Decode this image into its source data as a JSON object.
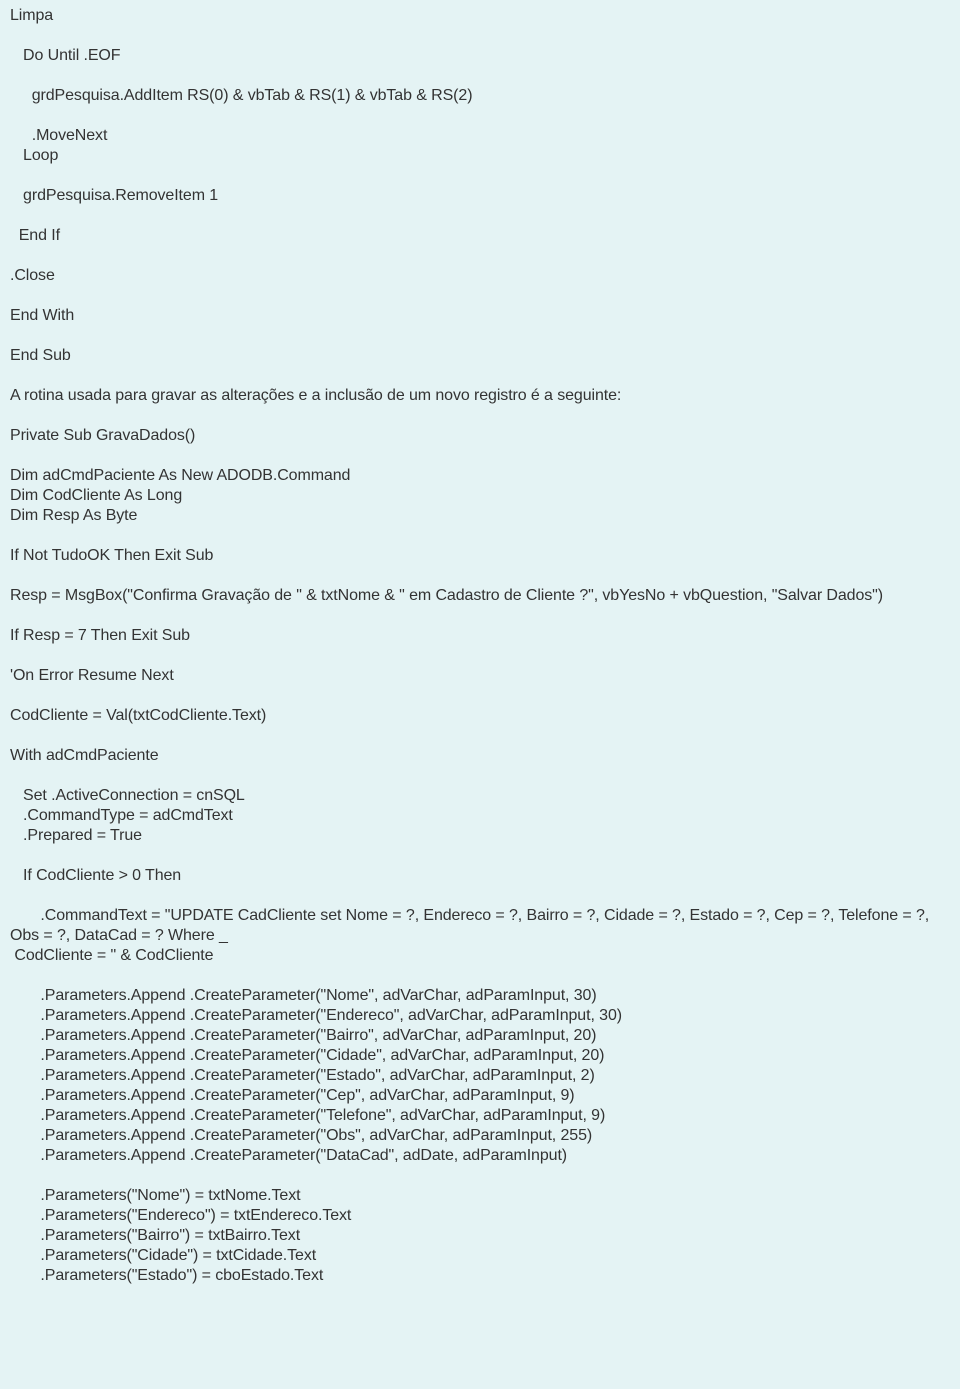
{
  "blocks": {
    "code1": "Limpa\n\n   Do Until .EOF\n\n     grdPesquisa.AddItem RS(0) & vbTab & RS(1) & vbTab & RS(2)\n\n     .MoveNext\n   Loop\n\n   grdPesquisa.RemoveItem 1\n\n  End If\n\n.Close\n\nEnd With\n\nEnd Sub",
    "para1": "A rotina usada para gravar as alterações e a inclusão de um novo registro é a seguinte:",
    "code2": "Private Sub GravaDados()\n\nDim adCmdPaciente As New ADODB.Command\nDim CodCliente As Long\nDim Resp As Byte\n\nIf Not TudoOK Then Exit Sub\n\nResp = MsgBox(\"Confirma Gravação de \" & txtNome & \" em Cadastro de Cliente ?\", vbYesNo + vbQuestion, \"Salvar Dados\")\n\nIf Resp = 7 Then Exit Sub\n\n'On Error Resume Next\n\nCodCliente = Val(txtCodCliente.Text)\n\nWith adCmdPaciente\n\n   Set .ActiveConnection = cnSQL\n   .CommandType = adCmdText\n   .Prepared = True\n\n   If CodCliente > 0 Then\n\n       .CommandText = \"UPDATE CadCliente set Nome = ?, Endereco = ?, Bairro = ?, Cidade = ?, Estado = ?, Cep = ?, Telefone = ?, Obs = ?, DataCad = ? Where _\n CodCliente = \" & CodCliente\n\n       .Parameters.Append .CreateParameter(\"Nome\", adVarChar, adParamInput, 30)\n       .Parameters.Append .CreateParameter(\"Endereco\", adVarChar, adParamInput, 30)\n       .Parameters.Append .CreateParameter(\"Bairro\", adVarChar, adParamInput, 20)\n       .Parameters.Append .CreateParameter(\"Cidade\", adVarChar, adParamInput, 20)\n       .Parameters.Append .CreateParameter(\"Estado\", adVarChar, adParamInput, 2)\n       .Parameters.Append .CreateParameter(\"Cep\", adVarChar, adParamInput, 9)\n       .Parameters.Append .CreateParameter(\"Telefone\", adVarChar, adParamInput, 9)\n       .Parameters.Append .CreateParameter(\"Obs\", adVarChar, adParamInput, 255)\n       .Parameters.Append .CreateParameter(\"DataCad\", adDate, adParamInput)\n\n       .Parameters(\"Nome\") = txtNome.Text\n       .Parameters(\"Endereco\") = txtEndereco.Text\n       .Parameters(\"Bairro\") = txtBairro.Text\n       .Parameters(\"Cidade\") = txtCidade.Text\n       .Parameters(\"Estado\") = cboEstado.Text"
  }
}
